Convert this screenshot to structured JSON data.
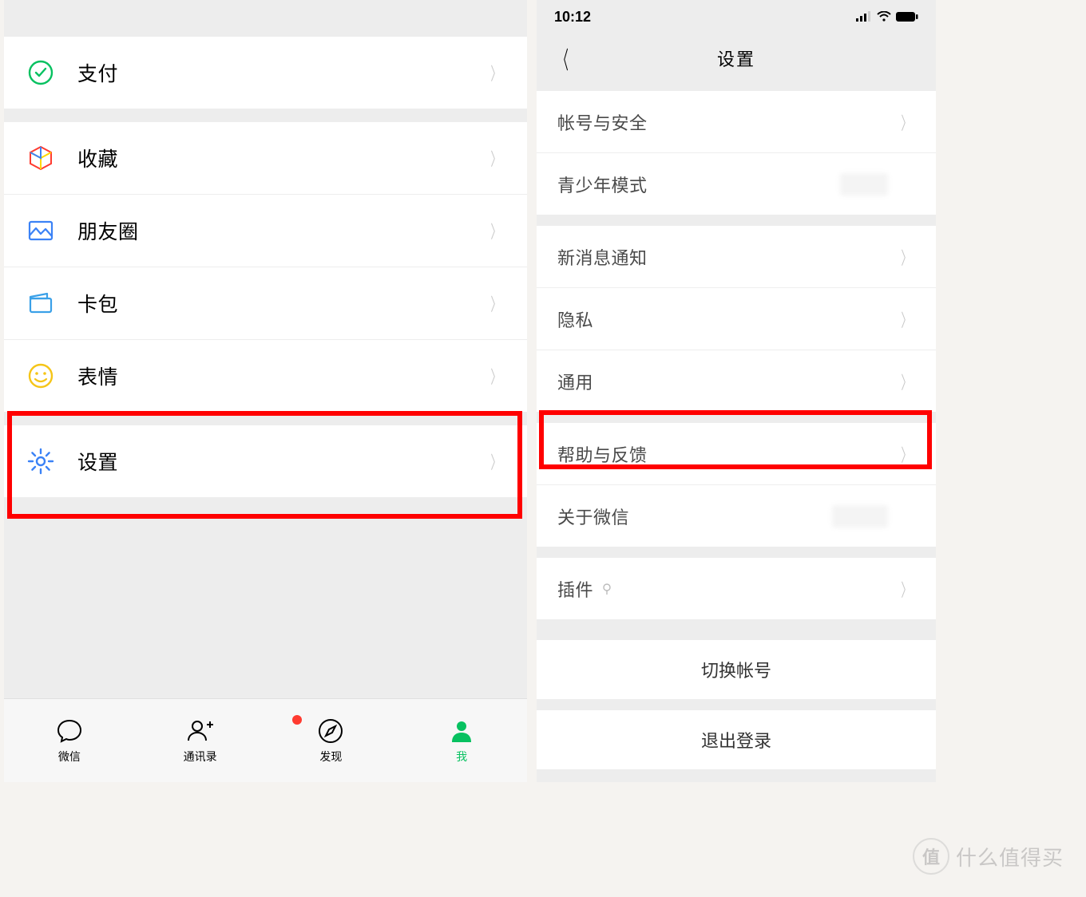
{
  "left": {
    "items": [
      {
        "label": "支付"
      },
      {
        "label": "收藏"
      },
      {
        "label": "朋友圈"
      },
      {
        "label": "卡包"
      },
      {
        "label": "表情"
      },
      {
        "label": "设置"
      }
    ],
    "tabs": [
      {
        "label": "微信"
      },
      {
        "label": "通讯录"
      },
      {
        "label": "发现"
      },
      {
        "label": "我"
      }
    ]
  },
  "right": {
    "status_time": "10:12",
    "nav_title": "设置",
    "rows": [
      {
        "label": "帐号与安全"
      },
      {
        "label": "青少年模式"
      },
      {
        "label": "新消息通知"
      },
      {
        "label": "隐私"
      },
      {
        "label": "通用"
      },
      {
        "label": "帮助与反馈"
      },
      {
        "label": "关于微信"
      },
      {
        "label": "插件"
      },
      {
        "label": "切换帐号"
      },
      {
        "label": "退出登录"
      }
    ]
  },
  "watermark": "什么值得买"
}
